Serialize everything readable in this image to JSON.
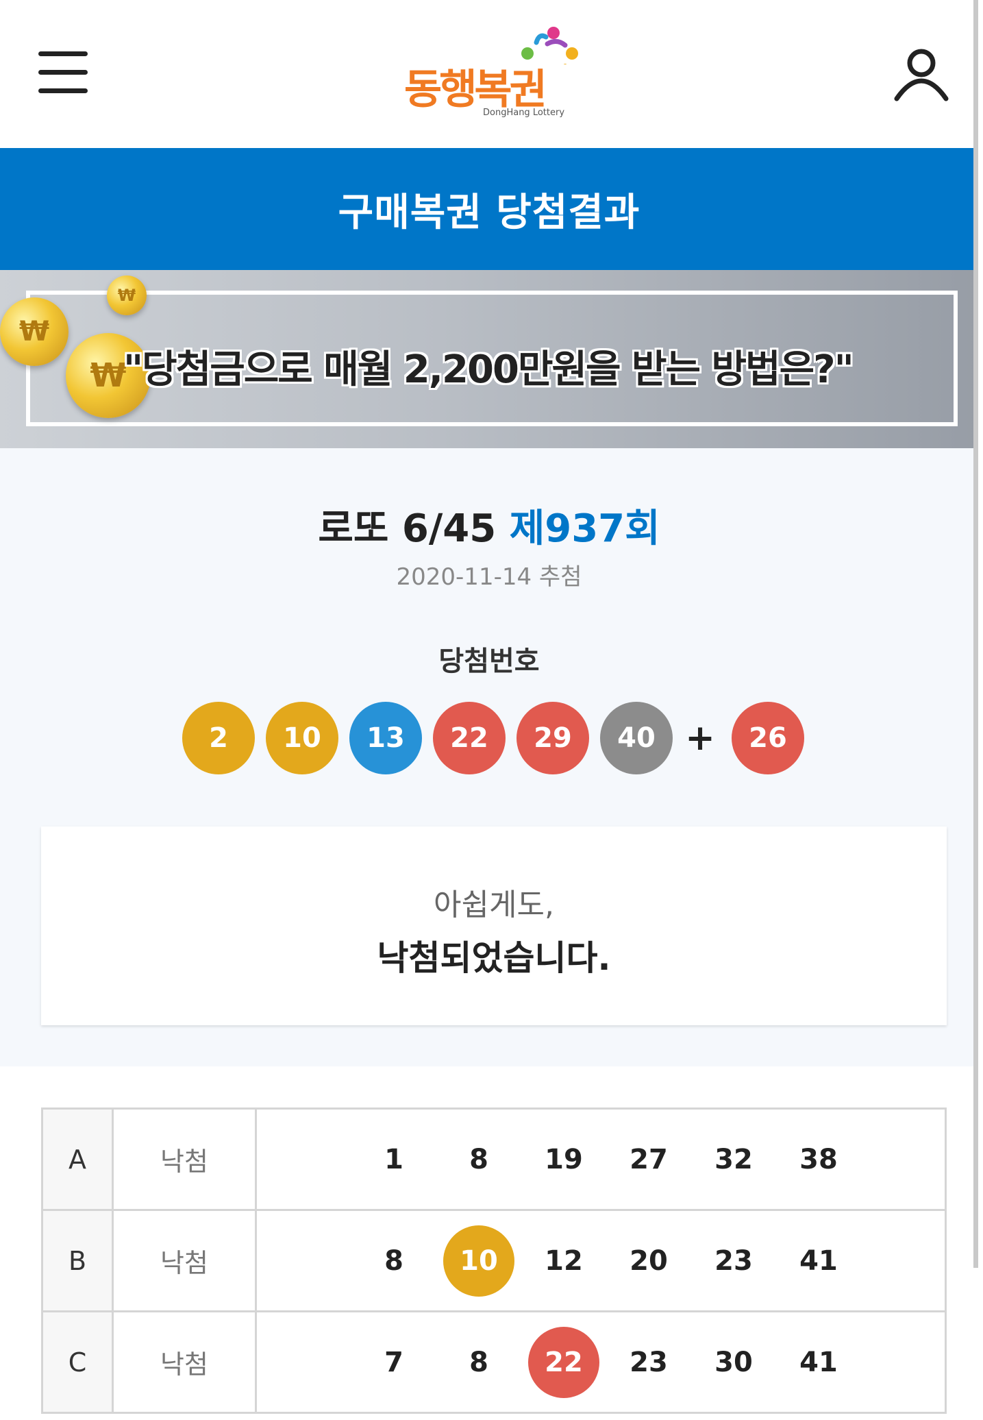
{
  "header": {
    "logo_text": "동행복권",
    "logo_sub": "DongHang Lottery"
  },
  "title_bar": {
    "title": "구매복권 당첨결과"
  },
  "banner": {
    "headline": "\"당첨금으로 매월 2,200만원을 받는 방법은?\"",
    "coin_symbol": "₩"
  },
  "result": {
    "game": "로또 6/45",
    "round": "제937회",
    "draw_date": "2020-11-14 추첨",
    "winning_label": "당첨번호",
    "winning_numbers": [
      "2",
      "10",
      "13",
      "22",
      "29",
      "40"
    ],
    "plus_symbol": "+",
    "bonus_number": "26",
    "ball_colors": [
      "#e3a81c",
      "#e3a81c",
      "#2792d7",
      "#e15a4f",
      "#e15a4f",
      "#8c8c8c"
    ],
    "bonus_color": "#e15a4f",
    "message_line1": "아쉽게도,",
    "message_line2": "낙첨되었습니다."
  },
  "tickets": [
    {
      "id": "A",
      "result": "낙첨",
      "numbers": [
        "1",
        "8",
        "19",
        "27",
        "32",
        "38"
      ],
      "matched": []
    },
    {
      "id": "B",
      "result": "낙첨",
      "numbers": [
        "8",
        "10",
        "12",
        "20",
        "23",
        "41"
      ],
      "matched": [
        "10"
      ]
    },
    {
      "id": "C",
      "result": "낙첨",
      "numbers": [
        "7",
        "8",
        "22",
        "23",
        "30",
        "41"
      ],
      "matched": [
        "22"
      ]
    }
  ],
  "colors": {
    "primary_blue": "#0076c8",
    "logo_orange": "#f07a22"
  }
}
